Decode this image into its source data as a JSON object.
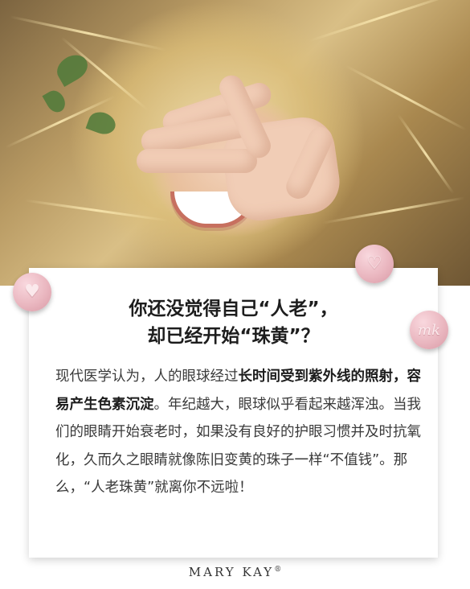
{
  "card": {
    "title_line1": "你还没觉得自己“人老”，",
    "title_line2": "却已经开始“珠黄”？",
    "body_parts": [
      {
        "text": "现代医学认为，人的眼球经过",
        "bold": false
      },
      {
        "text": "长时间受到紫外线的照射，容易产生色素沉淀",
        "bold": true
      },
      {
        "text": "。年纪越大，眼球似乎看起来越浑浊。当我们的眼睛开始衰老时，如果没有良好的护眼习惯并及时抗氧化，久而久之眼睛就像陈旧变黄的珠子一样“不值钱”。那么，“人老珠黄”就离你不远啦！",
        "bold": false
      }
    ]
  },
  "pins": {
    "left_icon": "heart-icon",
    "top_icon": "heart-icon",
    "right_icon": "mk-logo-icon",
    "right_text": "mk"
  },
  "footer": {
    "brand": "MARY KAY",
    "registered": "®"
  },
  "colors": {
    "pin_pink": "#eab7c0",
    "title": "#1d1d1d",
    "body": "#3a3a3a"
  }
}
